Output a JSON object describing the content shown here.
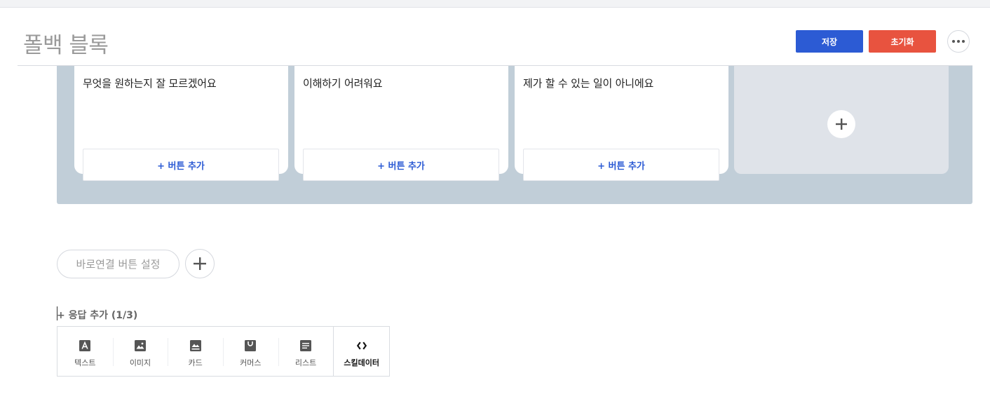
{
  "header": {
    "title": "폴백 블록",
    "save_label": "저장",
    "reset_label": "초기화",
    "more_icon": "more-dots-icon"
  },
  "cards": [
    {
      "message": "무엇을 원하는지 잘 모르겠어요",
      "add_button": "+ 버튼 추가"
    },
    {
      "message": "이해하기 어려워요",
      "add_button": "+ 버튼 추가"
    },
    {
      "message": "제가 할 수 있는 일이 아니에요",
      "add_button": "+ 버튼 추가"
    }
  ],
  "add_card_icon": "plus-icon",
  "quick_reply": {
    "label": "바로연결 버튼 설정",
    "add_icon": "plus-icon"
  },
  "add_response": {
    "label": "+ 응답 추가 (1/3)"
  },
  "response_types": [
    {
      "label": "텍스트",
      "icon": "text-icon"
    },
    {
      "label": "이미지",
      "icon": "image-icon"
    },
    {
      "label": "카드",
      "icon": "card-icon"
    },
    {
      "label": "커머스",
      "icon": "commerce-bag-icon"
    },
    {
      "label": "리스트",
      "icon": "list-icon"
    },
    {
      "label": "스킬데이터",
      "icon": "code-brackets-icon"
    }
  ],
  "colors": {
    "primary": "#2c5bd4",
    "danger": "#e8533f",
    "carousel_bg": "#c1ced8",
    "placeholder_card": "#dfe3e9",
    "title_gray": "#9a9a9a"
  }
}
